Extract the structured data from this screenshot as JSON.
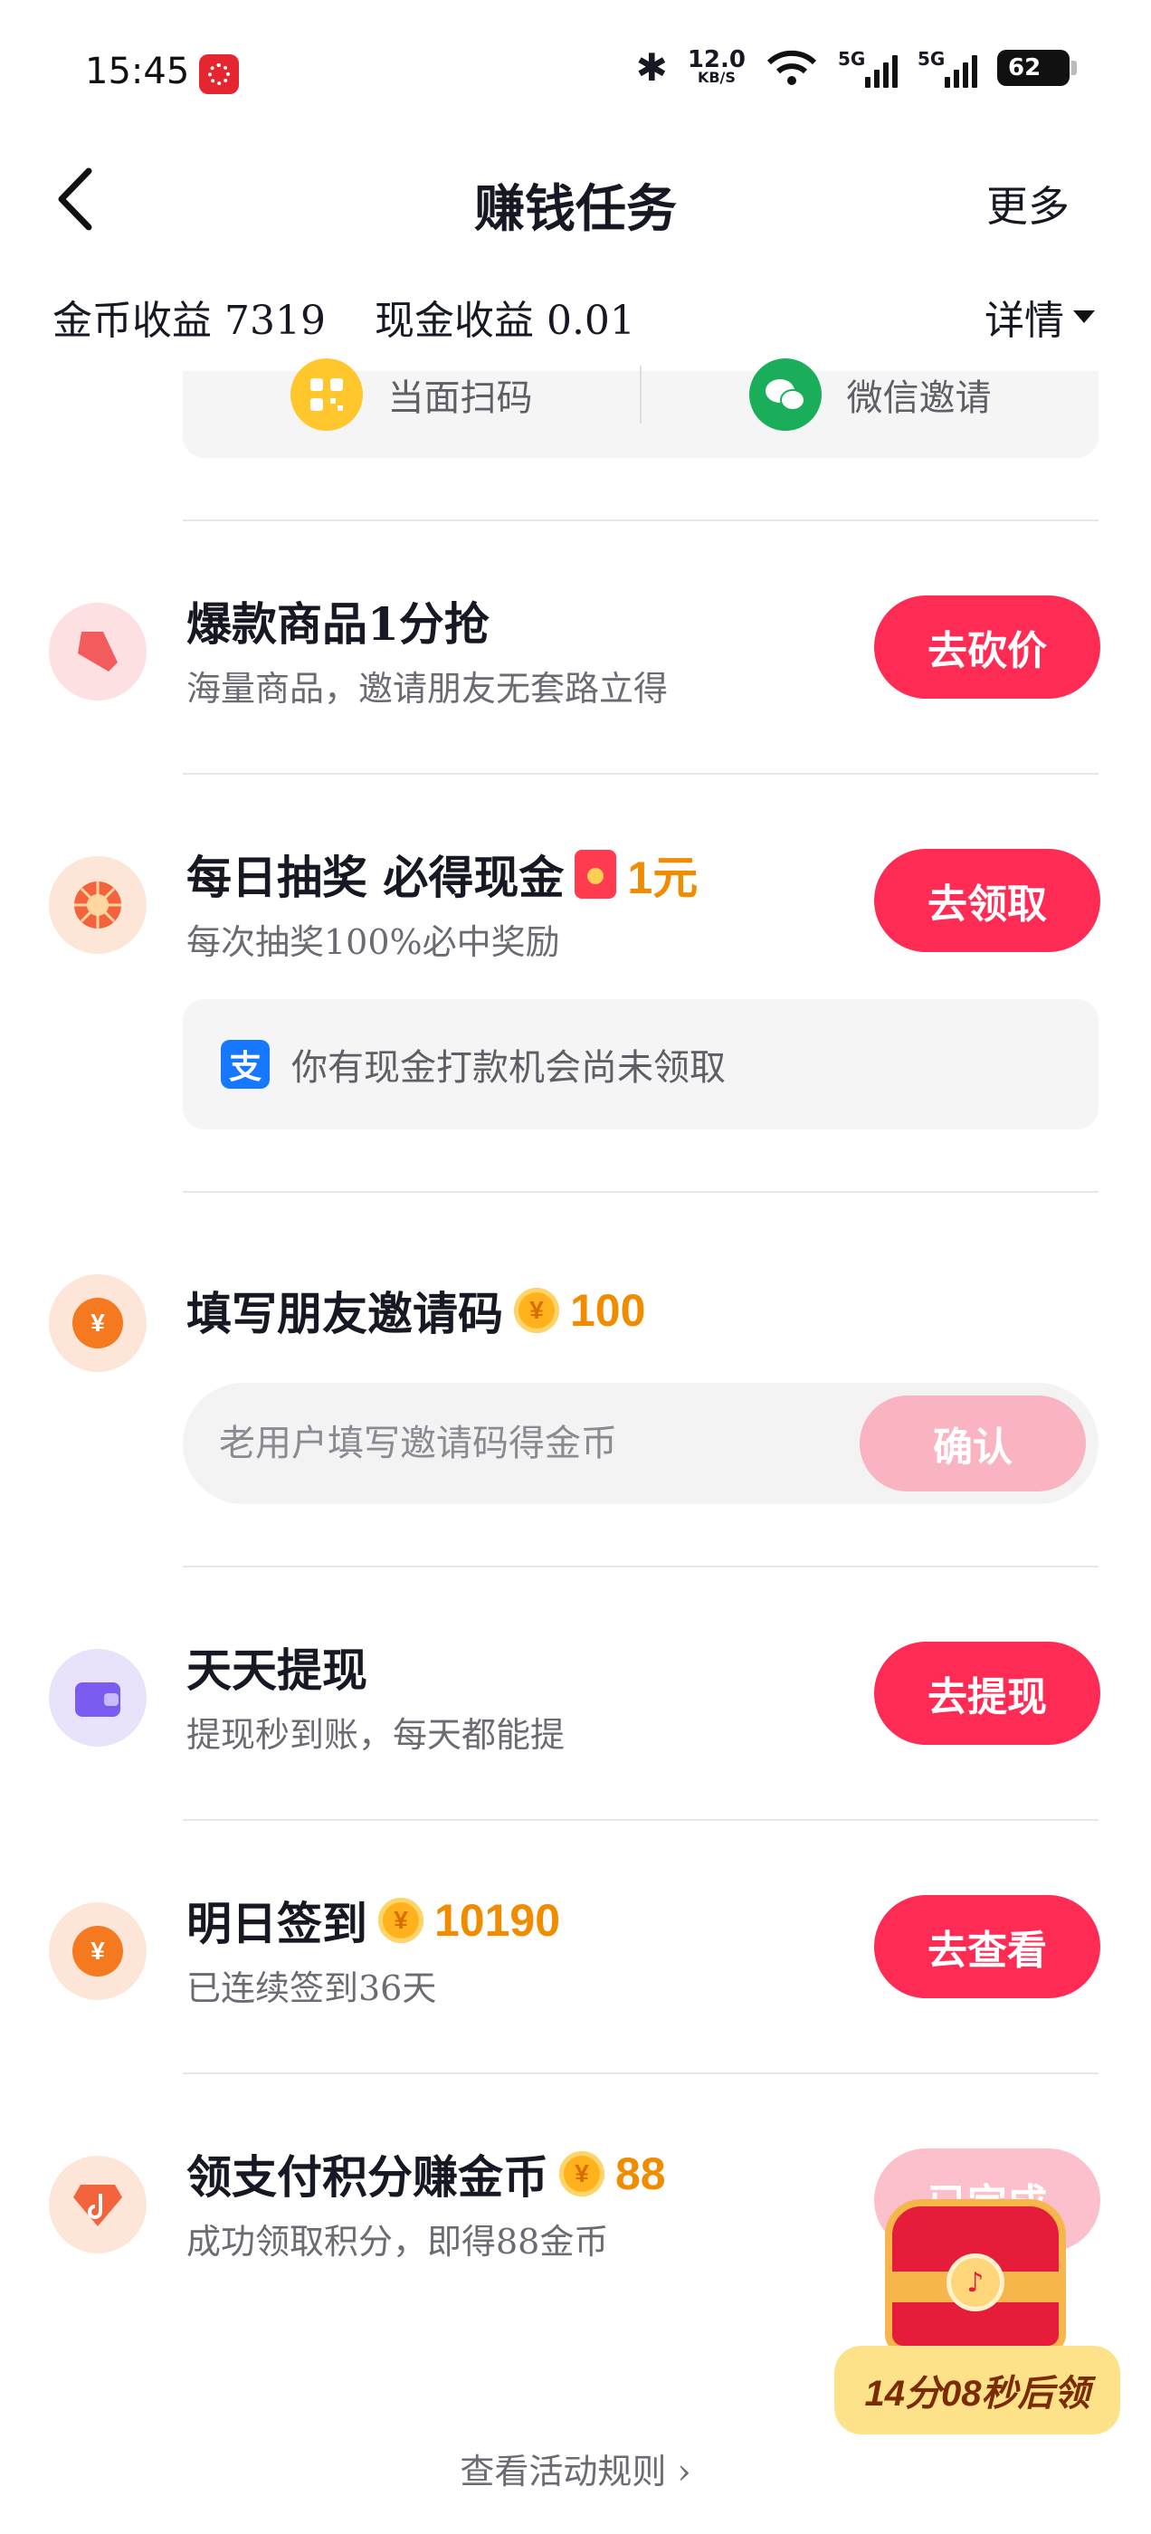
{
  "status_bar": {
    "time": "15:45",
    "net_speed_value": "12.0",
    "net_speed_unit": "KB/S",
    "signal1_label": "5G",
    "signal2_label": "5G",
    "battery": "62"
  },
  "nav": {
    "title": "赚钱任务",
    "more_label": "更多"
  },
  "earnings": {
    "coin_income": "金币收益 7319",
    "cash_income": "现金收益 0.01",
    "detail_label": "详情"
  },
  "invite": {
    "scan_label": "当面扫码",
    "wechat_label": "微信邀请"
  },
  "tasks": [
    {
      "title": "爆款商品1分抢",
      "subtitle": "海量商品，邀请朋友无套路立得",
      "button": "去砍价"
    },
    {
      "title": "每日抽奖 必得现金",
      "reward": "1元",
      "subtitle": "每次抽奖100%必中奖励",
      "button": "去领取",
      "notice": "你有现金打款机会尚未领取",
      "notice_icon_char": "支"
    },
    {
      "title": "填写朋友邀请码",
      "reward": "100",
      "input_placeholder": "老用户填写邀请码得金币",
      "button": "确认"
    },
    {
      "title": "天天提现",
      "subtitle": "提现秒到账，每天都能提",
      "button": "去提现"
    },
    {
      "title": "明日签到",
      "reward": "10190",
      "subtitle": "已连续签到36天",
      "button": "去查看"
    },
    {
      "title": "领支付积分赚金币",
      "reward": "88",
      "subtitle": "成功领取积分，即得88金币",
      "button": "已完成"
    }
  ],
  "chest": {
    "timer": "14分08秒后领"
  },
  "footer": {
    "rules_link": "查看活动规则"
  },
  "icons": {
    "back": "chevron-left-icon",
    "scan": "qr-code-icon",
    "wechat": "wechat-icon",
    "deal": "price-tag-icon",
    "lottery": "lottery-wheel-icon",
    "coin": "yuan-coin-icon",
    "wallet": "wallet-icon",
    "points": "diamond-music-icon",
    "chest": "treasure-chest-icon"
  },
  "colors": {
    "primary_button": "#fe2c55",
    "disabled_button": "#f9b3c1",
    "reward": "#f08c00"
  },
  "currency_symbol": "¥"
}
